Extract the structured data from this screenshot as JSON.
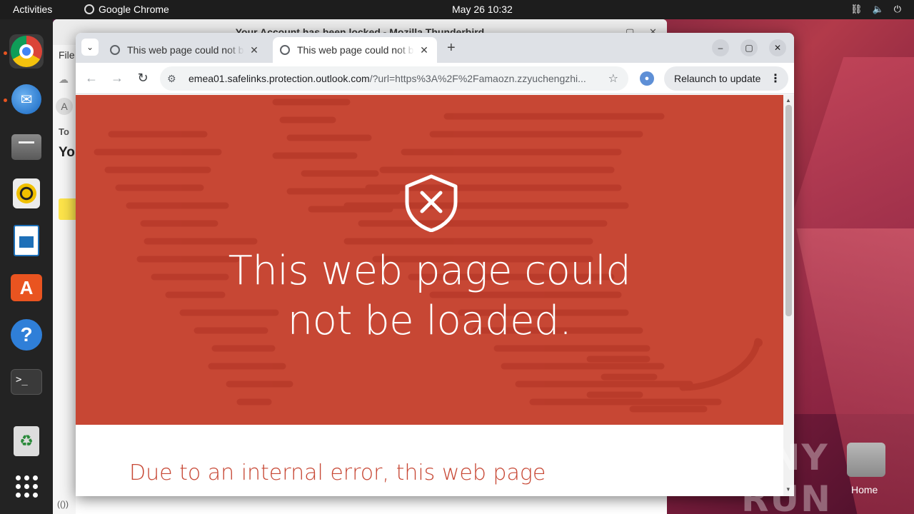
{
  "topbar": {
    "activities": "Activities",
    "app_name": "Google Chrome",
    "clock": "May 26  10:32"
  },
  "thunderbird": {
    "title": "Your Account has been locked - Mozilla Thunderbird",
    "menu_file": "File",
    "to_label": "To",
    "subject_fragment": "Yo",
    "avatar_letter": "A",
    "status": "(())"
  },
  "chrome": {
    "tabs": [
      {
        "label": "This web page could not be loaded.",
        "active": false
      },
      {
        "label": "This web page could not be loaded.",
        "active": true
      }
    ],
    "url_host": "emea01.safelinks.protection.outlook.com",
    "url_path": "/?url=https%3A%2F%2Famaozn.zzyuchengzhi...",
    "relaunch": "Relaunch to update"
  },
  "page": {
    "headline_line1": "This web page could",
    "headline_line2": "not be loaded.",
    "subheading": "Due to an internal error, this web page",
    "banner_color": "#c74734"
  },
  "desktop": {
    "home_label": "Home",
    "watermark": "ANY RUN"
  }
}
